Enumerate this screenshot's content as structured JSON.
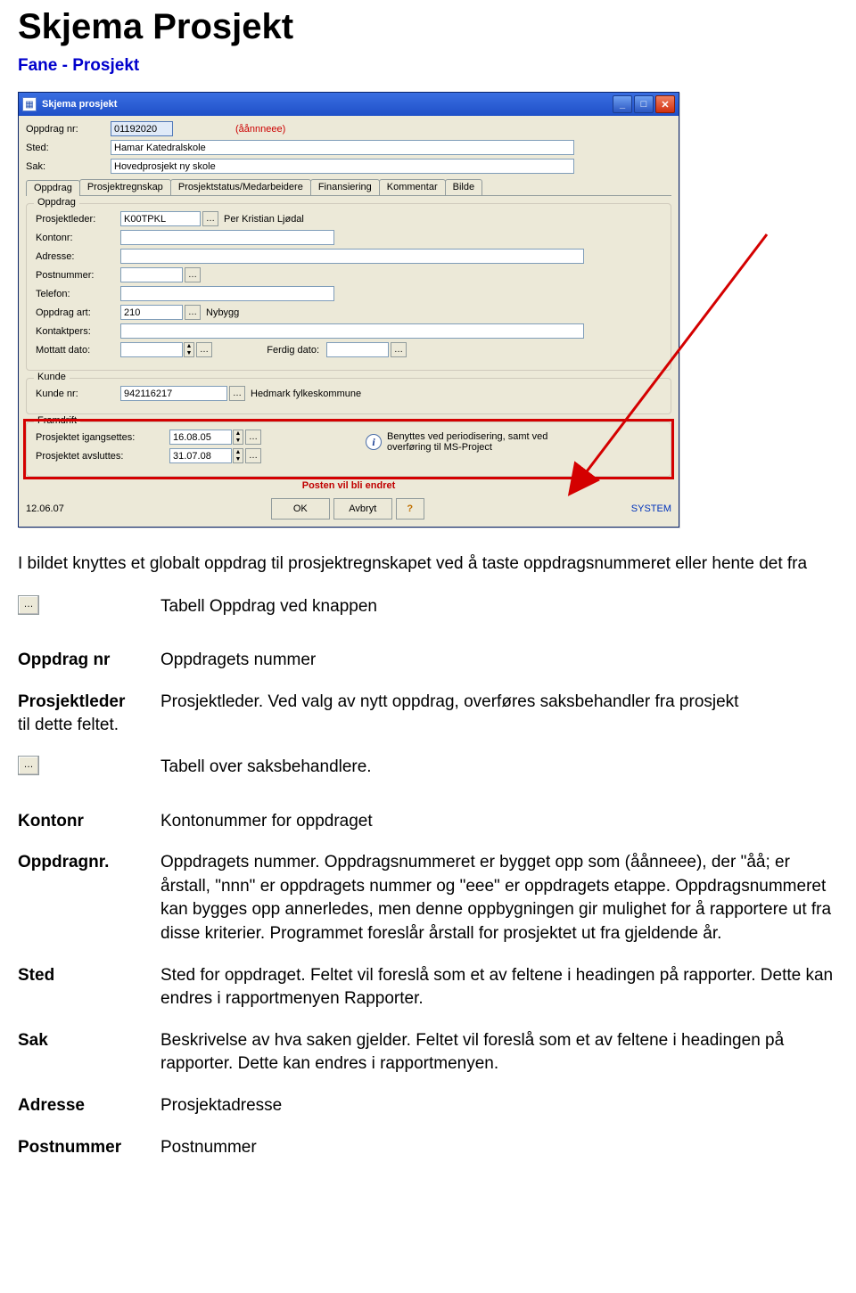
{
  "title": "Skjema Prosjekt",
  "subhead": "Fane - Prosjekt",
  "window": {
    "title": "Skjema prosjekt",
    "header": {
      "oppdrag_nr_label": "Oppdrag nr:",
      "oppdrag_nr_value": "01192020",
      "oppdrag_nr_hint": "(åånnneee)",
      "sted_label": "Sted:",
      "sted_value": "Hamar Katedralskole",
      "sak_label": "Sak:",
      "sak_value": "Hovedprosjekt ny skole"
    },
    "tabs": [
      "Oppdrag",
      "Prosjektregnskap",
      "Prosjektstatus/Medarbeidere",
      "Finansiering",
      "Kommentar",
      "Bilde"
    ],
    "oppdrag_group": {
      "legend": "Oppdrag",
      "prosjektleder_label": "Prosjektleder:",
      "prosjektleder_value": "K00TPKL",
      "prosjektleder_name": "Per Kristian Ljødal",
      "kontonr_label": "Kontonr:",
      "adresse_label": "Adresse:",
      "postnr_label": "Postnummer:",
      "telefon_label": "Telefon:",
      "oppdrag_art_label": "Oppdrag art:",
      "oppdrag_art_value": "210",
      "oppdrag_art_name": "Nybygg",
      "kontaktpers_label": "Kontaktpers:",
      "mottatt_dato_label": "Mottatt dato:",
      "ferdig_dato_label": "Ferdig dato:"
    },
    "kunde_group": {
      "legend": "Kunde",
      "kundenr_label": "Kunde nr:",
      "kundenr_value": "942116217",
      "kundenr_name": "Hedmark fylkeskommune"
    },
    "framdrift_group": {
      "legend": "Framdrift",
      "igang_label": "Prosjektet igangsettes:",
      "igang_value": "16.08.05",
      "avslutt_label": "Prosjektet avsluttes:",
      "avslutt_value": "31.07.08",
      "info_text": "Benyttes ved periodisering, samt ved overføring til MS-Project"
    },
    "posten_msg": "Posten vil bli endret",
    "footer": {
      "date": "12.06.07",
      "ok": "OK",
      "avbryt": "Avbryt",
      "q": "?",
      "system": "SYSTEM"
    }
  },
  "intro": "I bildet knyttes et globalt oppdrag til prosjektregnskapet ved å taste oppdragsnummeret eller hente det fra",
  "defs": {
    "lookup_row": "Tabell Oppdrag ved knappen",
    "oppdrag_nr_term": "Oppdrag nr",
    "oppdrag_nr_def": "Oppdragets nummer",
    "prosjektleder_term": "Prosjektleder",
    "prosjektleder_extra": "til dette feltet.",
    "prosjektleder_def": "Prosjektleder. Ved valg av nytt oppdrag, overføres saksbehandler fra prosjekt",
    "saksb_row": "Tabell over saksbehandlere.",
    "kontonr_term": "Kontonr",
    "kontonr_def": "Kontonummer for oppdraget",
    "oppdragnr_term": "Oppdragnr.",
    "oppdragnr_def": "Oppdragets nummer. Oppdragsnummeret er bygget opp som (åånneee), der \"åå; er årstall, \"nnn\" er oppdragets nummer og \"eee\"  er oppdragets etappe.  Oppdragsnummeret kan bygges opp annerledes, men denne oppbygningen gir mulighet for å rapportere ut fra disse kriterier. Programmet foreslår årstall for prosjektet ut fra gjeldende år.",
    "sted_term": "Sted",
    "sted_def": "Sted for oppdraget.  Feltet vil foreslå som et av feltene i headingen på rapporter. Dette kan endres i rapportmenyen Rapporter.",
    "sak_term": "Sak",
    "sak_def": "Beskrivelse av hva saken gjelder. Feltet vil foreslå som et av feltene i headingen på rapporter. Dette kan endres i rapportmenyen.",
    "adresse_term": "Adresse",
    "adresse_def": "Prosjektadresse",
    "postnr_term": "Postnummer",
    "postnr_def": "Postnummer"
  }
}
